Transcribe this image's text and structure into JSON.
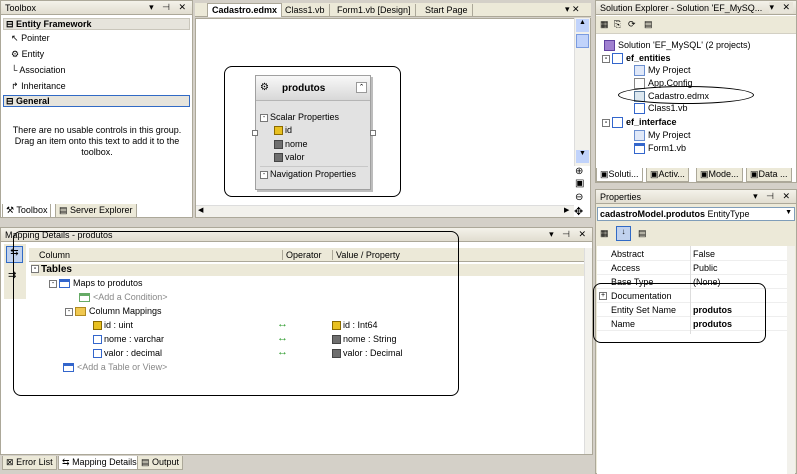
{
  "toolbox": {
    "title": "Toolbox",
    "section_ef": "Entity Framework",
    "items": [
      "Pointer",
      "Entity",
      "Association",
      "Inheritance"
    ],
    "section_general": "General",
    "empty_msg": "There are no usable controls in this group. Drag an item onto this text to add it to the toolbox.",
    "tabs": [
      "Toolbox",
      "Server Explorer"
    ]
  },
  "editor": {
    "tabs": [
      "Cadastro.edmx",
      "Class1.vb",
      "Form1.vb [Design]",
      "Start Page"
    ],
    "entity": {
      "name": "produtos",
      "scalar_header": "Scalar Properties",
      "properties": [
        "id",
        "nome",
        "valor"
      ],
      "nav_header": "Navigation Properties"
    }
  },
  "mapping": {
    "title": "Mapping Details - produtos",
    "columns": [
      "Column",
      "Operator",
      "Value / Property"
    ],
    "tables_label": "Tables",
    "maps_to": "Maps to produtos",
    "add_condition": "<Add a Condition>",
    "column_mappings": "Column Mappings",
    "rows": [
      {
        "column": "id : uint",
        "op": "↔",
        "value": "id : Int64"
      },
      {
        "column": "nome : varchar",
        "op": "↔",
        "value": "nome : String"
      },
      {
        "column": "valor : decimal",
        "op": "↔",
        "value": "valor : Decimal"
      }
    ],
    "add_table": "<Add a Table or View>"
  },
  "bottom_tabs": [
    "Error List",
    "Mapping Details",
    "Output"
  ],
  "solution": {
    "title": "Solution Explorer - Solution 'EF_MySQ...",
    "root": "Solution 'EF_MySQL' (2 projects)",
    "project1": "ef_entities",
    "p1_items": [
      "My Project",
      "App.Config",
      "Cadastro.edmx",
      "Class1.vb"
    ],
    "project2": "ef_interface",
    "p2_items": [
      "My Project",
      "Form1.vb"
    ],
    "tabs": [
      "Soluti...",
      "Activ...",
      "Mode...",
      "Data ..."
    ]
  },
  "properties": {
    "title": "Properties",
    "object": "cadastroModel.produtos",
    "object_type": "EntityType",
    "rows": [
      {
        "name": "Abstract",
        "value": "False",
        "bold": false
      },
      {
        "name": "Access",
        "value": "Public",
        "bold": false
      },
      {
        "name": "Base Type",
        "value": "(None)",
        "bold": false
      },
      {
        "name": "Documentation",
        "value": "",
        "bold": false,
        "expander": true
      },
      {
        "name": "Entity Set Name",
        "value": "produtos",
        "bold": true
      },
      {
        "name": "Name",
        "value": "produtos",
        "bold": true
      }
    ]
  }
}
